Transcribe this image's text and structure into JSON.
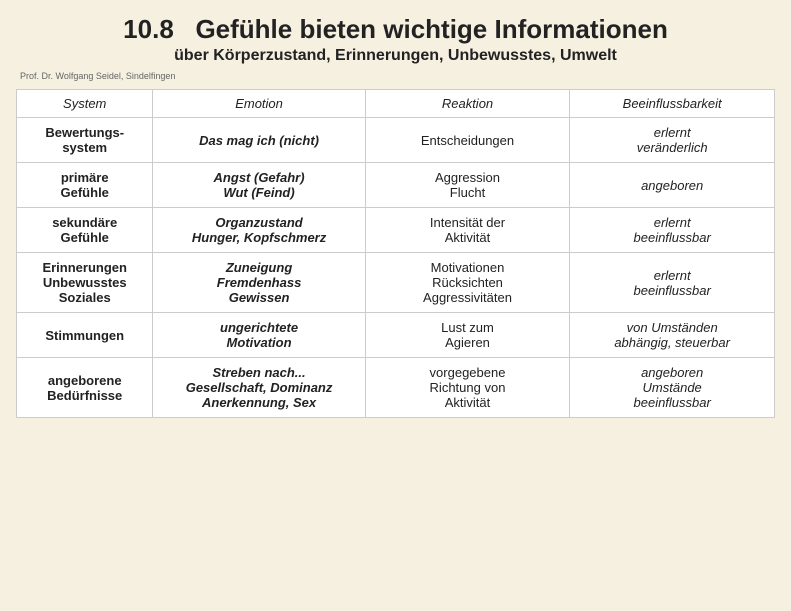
{
  "header": {
    "number": "10.8",
    "title": "Gefühle bieten wichtige Informationen",
    "subtitle": "über Körperzustand, Erinnerungen, Unbewusstes, Umwelt",
    "author": "Prof. Dr. Wolfgang Seidel, Sindelfingen"
  },
  "table": {
    "columns": [
      {
        "key": "system",
        "label": "System"
      },
      {
        "key": "emotion",
        "label": "Emotion"
      },
      {
        "key": "reaction",
        "label": "Reaktion"
      },
      {
        "key": "influence",
        "label": "Beeinflussbarkeit"
      }
    ],
    "rows": [
      {
        "system": "Bewertungs-\nsystem",
        "emotion": "Das mag ich (nicht)",
        "reaction": "Entscheidungen",
        "influence": "erlernt\nveränderlich"
      },
      {
        "system": "primäre\nGefühle",
        "emotion": "Angst (Gefahr)\nWut (Feind)",
        "reaction": "Aggression\nFlucht",
        "influence": "angeboren"
      },
      {
        "system": "sekundäre\nGefühle",
        "emotion": "Organzustand\nHunger, Kopfschmerz",
        "reaction": "Intensität der\nAktivität",
        "influence": "erlernt\nbeeinflussbar"
      },
      {
        "system": "Erinnerungen\nUnbewusstes\nSoziales",
        "emotion": "Zuneigung\nFremdenhass\nGewissen",
        "reaction": "Motivationen\nRücksichten\nAggressivitäten",
        "influence": "erlernt\nbeeinflussbar"
      },
      {
        "system": "Stimmungen",
        "emotion": "ungerichtete\nMotivation",
        "reaction": "Lust zum\nAgieren",
        "influence": "von Umständen\nabhängig, steuerbar"
      },
      {
        "system": "angeborene\nBedürfnisse",
        "emotion": "Streben nach...\nGesellschaft, Dominanz\nAnerkennung, Sex",
        "reaction": "vorgegebene\nRichtung von\nAktivität",
        "influence": "angeboren\nUmstände\nbeeinflussbar"
      }
    ]
  }
}
